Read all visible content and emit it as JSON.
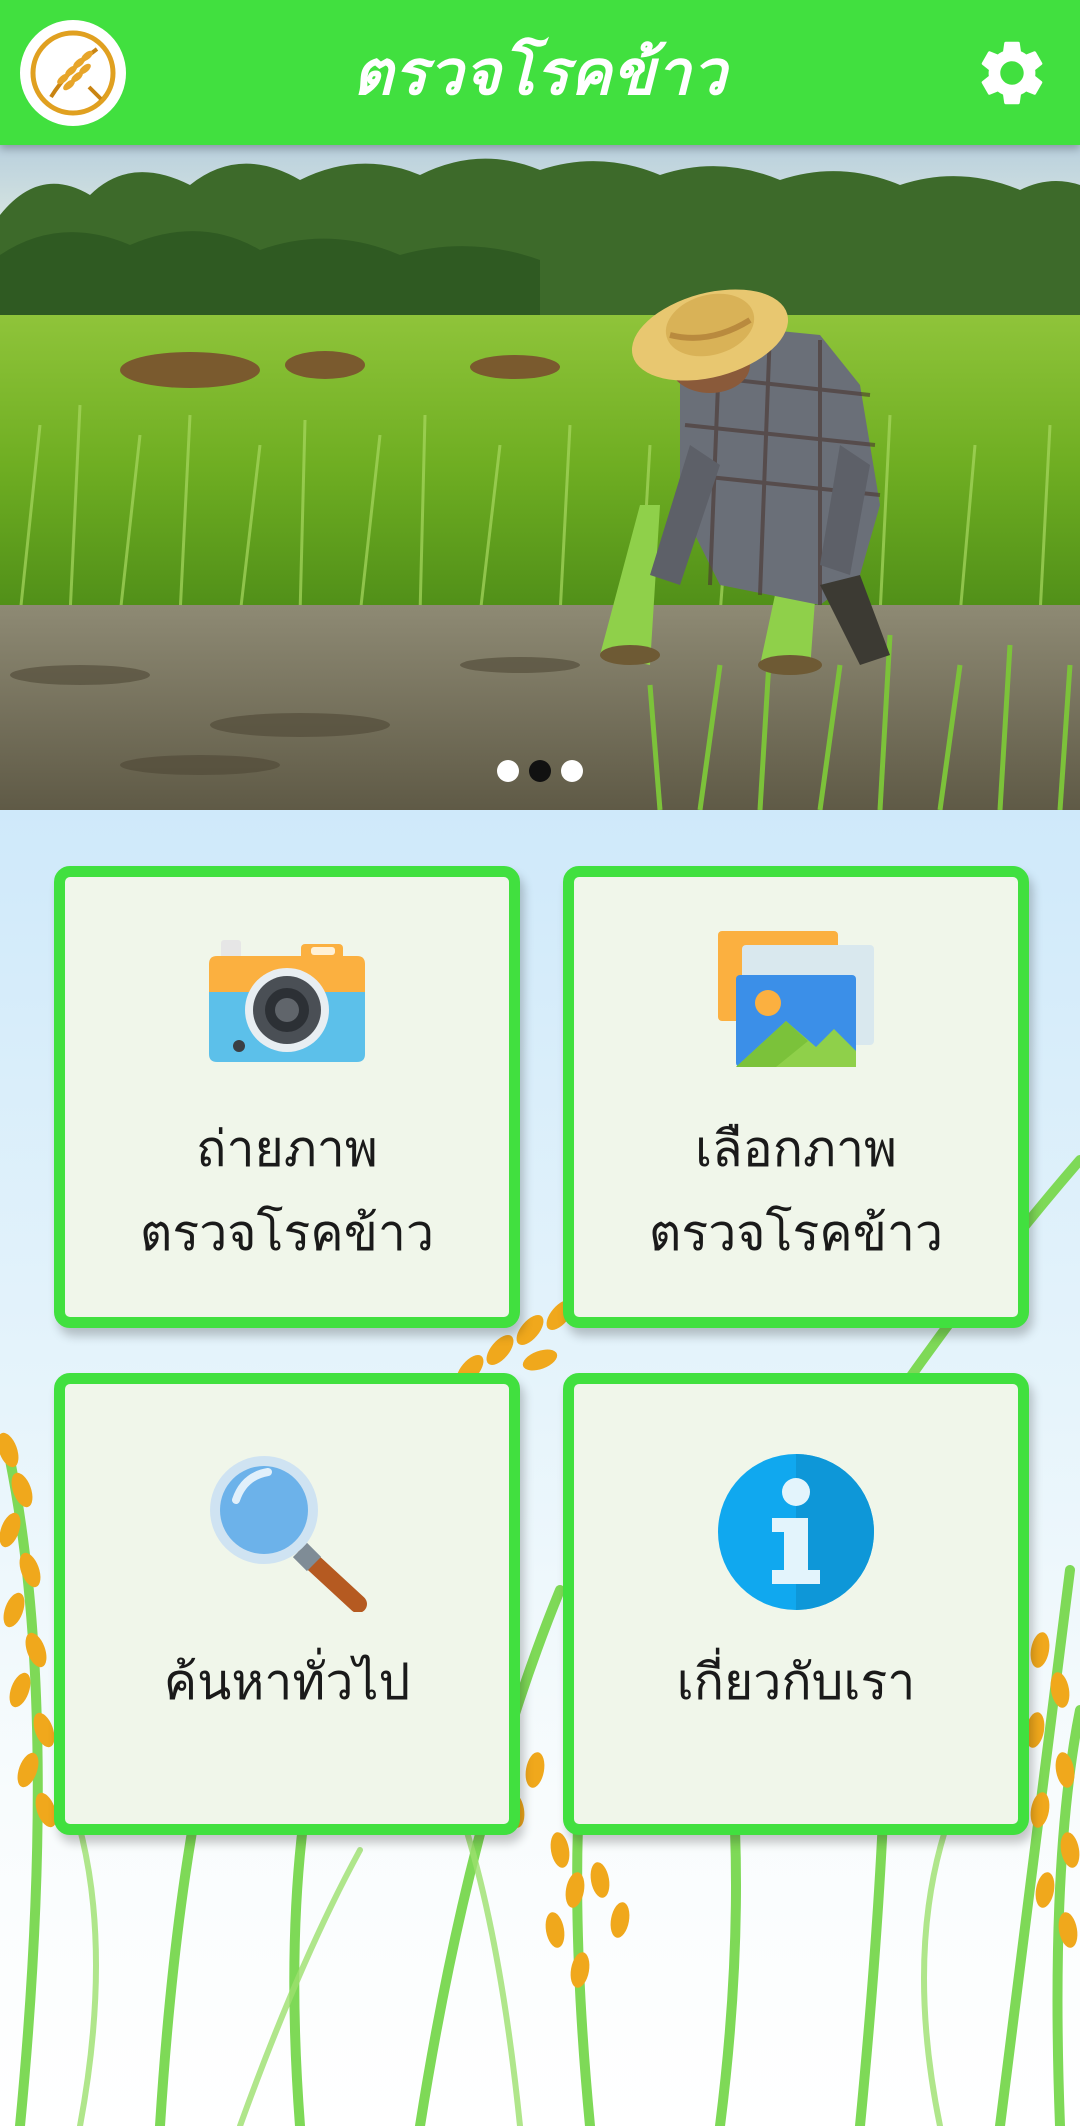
{
  "header": {
    "title": "ตรวจโรคข้าว",
    "logo_icon": "rice-leaf-logo-icon",
    "settings_icon": "gear-icon"
  },
  "banner": {
    "image": "farmer-planting-rice-photo",
    "slide_count": 3,
    "active_slide": 2
  },
  "cards": [
    {
      "id": "camera",
      "icon": "camera-icon",
      "line1": "ถ่ายภาพ",
      "line2": "ตรวจโรคข้าว"
    },
    {
      "id": "gallery",
      "icon": "gallery-image-icon",
      "line1": "เลือกภาพ",
      "line2": "ตรวจโรคข้าว"
    },
    {
      "id": "search",
      "icon": "magnifier-icon",
      "line1": "ค้นหาทั่วไป"
    },
    {
      "id": "about",
      "icon": "info-icon",
      "line1": "เกี่ยวกับเรา"
    }
  ],
  "colors": {
    "brand_green": "#41e03f",
    "card_bg": "#f0f6ea",
    "text": "#1a1a1a"
  }
}
